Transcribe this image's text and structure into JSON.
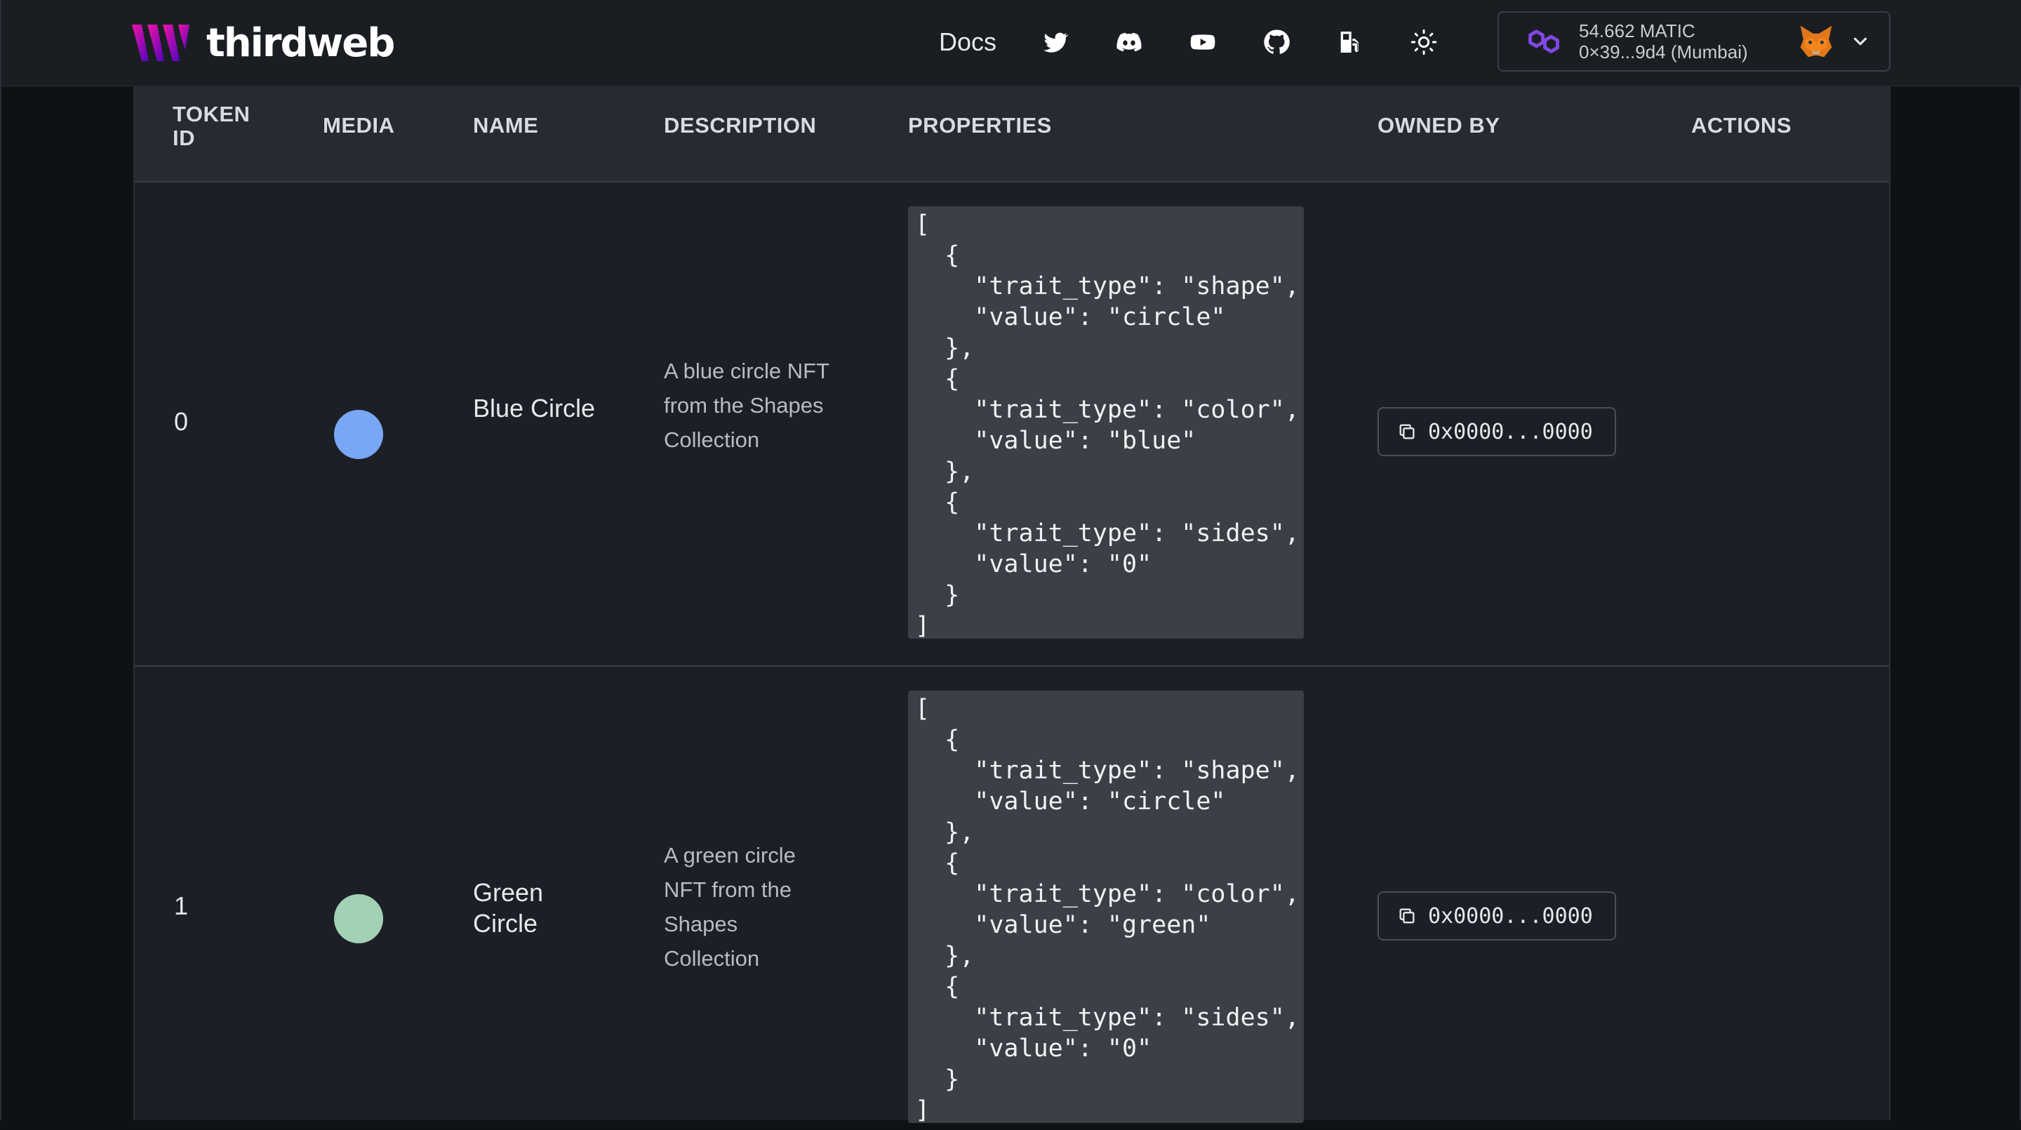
{
  "header": {
    "brand": "thirdweb",
    "nav": {
      "docs_label": "Docs",
      "icons": [
        "twitter-icon",
        "discord-icon",
        "youtube-icon",
        "github-icon",
        "gas-pump-icon",
        "sun-icon"
      ]
    },
    "wallet": {
      "balance": "54.662 MATIC",
      "address": "0×39...9d4 (Mumbai)",
      "chain_icon": "polygon-icon",
      "avatar_icon": "metamask-fox-icon"
    }
  },
  "table": {
    "headers": {
      "token_id": "TOKEN ID",
      "media": "MEDIA",
      "name": "NAME",
      "description": "DESCRIPTION",
      "properties": "PROPERTIES",
      "owned_by": "OWNED BY",
      "actions": "ACTIONS"
    },
    "rows": [
      {
        "token_id": "0",
        "media_color": "#7aa7f5",
        "name": "Blue Circle",
        "description": "A blue circle NFT from the Shapes Collection",
        "properties": "[\n  {\n    \"trait_type\": \"shape\",\n    \"value\": \"circle\"\n  },\n  {\n    \"trait_type\": \"color\",\n    \"value\": \"blue\"\n  },\n  {\n    \"trait_type\": \"sides\",\n    \"value\": \"0\"\n  }\n]",
        "owned_by": "0x0000...0000"
      },
      {
        "token_id": "1",
        "media_color": "#a3d1b5",
        "name": "Green Circle",
        "description": "A green circle NFT from the Shapes Collection",
        "properties": "[\n  {\n    \"trait_type\": \"shape\",\n    \"value\": \"circle\"\n  },\n  {\n    \"trait_type\": \"color\",\n    \"value\": \"green\"\n  },\n  {\n    \"trait_type\": \"sides\",\n    \"value\": \"0\"\n  }\n]",
        "owned_by": "0x0000...0000"
      }
    ]
  },
  "colors": {
    "background": "#0f1215",
    "header": "#1a1e23",
    "table": "#1c2026",
    "table_header": "#262a31",
    "code_block": "#3b3f46",
    "brand_accent": "#b22ae0"
  }
}
